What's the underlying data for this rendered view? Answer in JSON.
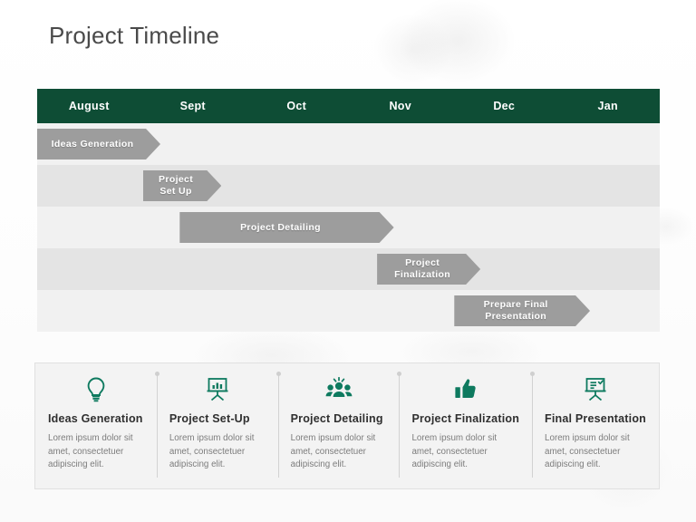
{
  "page_title": "Project Timeline",
  "colors": {
    "header_green": "#0e4d35",
    "bar_gray": "#9d9d9d",
    "row_light": "#f1f1f1",
    "row_dark": "#e4e4e4",
    "icon_teal": "#0e7a5f",
    "panel_bg": "#f3f3f3",
    "title_text": "#4a4a4a"
  },
  "timeline": {
    "months": [
      {
        "label": "August"
      },
      {
        "label": "Sept"
      },
      {
        "label": "Oct"
      },
      {
        "label": "Nov"
      },
      {
        "label": "Dec"
      },
      {
        "label": "Jan"
      }
    ],
    "bars": [
      {
        "label": "Ideas Generation",
        "left_pct": 0.0,
        "width_pct": 19.8,
        "band": "light"
      },
      {
        "label": "Project\nSet Up",
        "left_pct": 17.0,
        "width_pct": 12.6,
        "band": "dark"
      },
      {
        "label": "Project Detailing",
        "left_pct": 22.9,
        "width_pct": 34.4,
        "band": "light"
      },
      {
        "label": "Project\nFinalization",
        "left_pct": 54.6,
        "width_pct": 16.6,
        "band": "dark"
      },
      {
        "label": "Prepare Final\nPresentation",
        "left_pct": 67.0,
        "width_pct": 21.8,
        "band": "light"
      }
    ]
  },
  "legend": {
    "cards": [
      {
        "icon": "lightbulb-icon",
        "title": "Ideas Generation",
        "description": "Lorem ipsum dolor sit amet, consectetuer adipiscing elit."
      },
      {
        "icon": "presentation-chart-icon",
        "title": "Project Set-Up",
        "description": "Lorem ipsum dolor sit amet, consectetuer adipiscing elit."
      },
      {
        "icon": "team-group-icon",
        "title": "Project Detailing",
        "description": "Lorem ipsum dolor sit amet, consectetuer adipiscing elit."
      },
      {
        "icon": "thumbs-up-icon",
        "title": "Project Finalization",
        "description": "Lorem ipsum dolor sit amet, consectetuer adipiscing elit."
      },
      {
        "icon": "presentation-board-icon",
        "title": "Final Presentation",
        "description": "Lorem ipsum dolor sit amet, consectetuer adipiscing elit."
      }
    ]
  }
}
